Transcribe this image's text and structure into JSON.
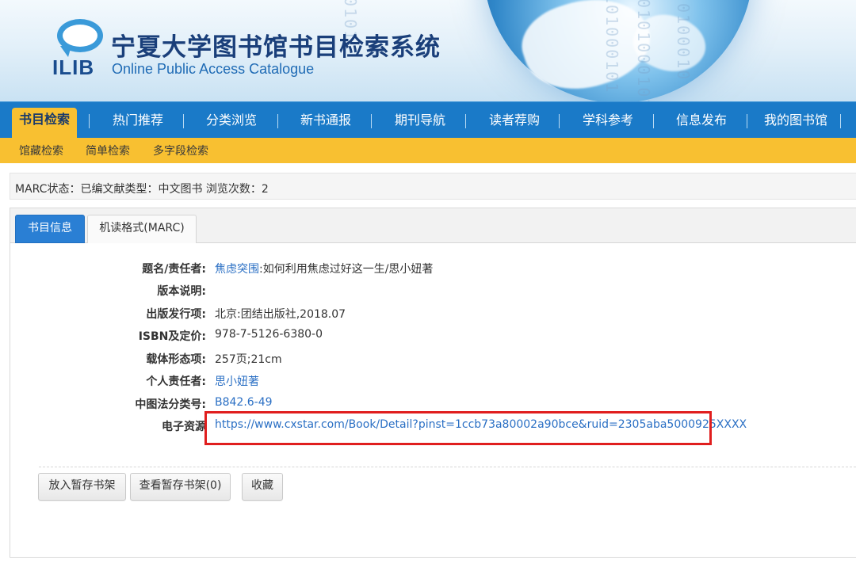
{
  "header": {
    "logo_text": "ILIB",
    "title": "宁夏大学图书馆书目检索系统",
    "subtitle": "Online Public Access Catalogue"
  },
  "nav": {
    "items": [
      {
        "label": "书目检索",
        "active": true
      },
      {
        "label": "热门推荐"
      },
      {
        "label": "分类浏览"
      },
      {
        "label": "新书通报"
      },
      {
        "label": "期刊导航"
      },
      {
        "label": "读者荐购"
      },
      {
        "label": "学科参考"
      },
      {
        "label": "信息发布"
      },
      {
        "label": "我的图书馆"
      }
    ],
    "active_color": "#f8c031",
    "bar_color": "#1a7ac8"
  },
  "subnav": {
    "items": [
      {
        "label": "馆藏检索"
      },
      {
        "label": "简单检索"
      },
      {
        "label": "多字段检索"
      }
    ]
  },
  "status": {
    "text": "MARC状态：已编文献类型：中文图书 浏览次数：2"
  },
  "tabs": [
    {
      "label": "书目信息",
      "active": true
    },
    {
      "label": "机读格式(MARC)"
    }
  ],
  "record": {
    "title_label": "题名/责任者:",
    "title_link": "焦虑突围",
    "title_rest": ":如何利用焦虑过好这一生/思小妞著",
    "edition_label": "版本说明:",
    "publisher_label": "出版发行项:",
    "publisher_value": "北京:团结出版社,2018.07",
    "isbn_label": "ISBN及定价:",
    "isbn_value": "978-7-5126-6380-0",
    "physical_label": "载体形态项:",
    "physical_value": "257页;21cm",
    "author_label": "个人责任者:",
    "author_value": "思小妞著",
    "classification_label": "中图法分类号:",
    "classification_value": "B842.6-49",
    "eresource_label": "电子资源",
    "eresource_value": "https://www.cxstar.com/Book/Detail?pinst=1ccb73a80002a90bce&ruid=2305aba5000925XXXX"
  },
  "actions": {
    "add_shelf": "放入暂存书架",
    "view_shelf": "查看暂存书架(0)",
    "favorite": "收藏"
  },
  "colors": {
    "link": "#2a6fc4",
    "highlight": "#e01e1e",
    "tab_active": "#2a7fd4"
  }
}
